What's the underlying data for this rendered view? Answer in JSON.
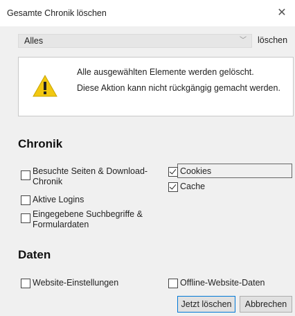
{
  "window": {
    "title": "Gesamte Chronik löschen"
  },
  "range": {
    "selected": "Alles",
    "trailing_label": "löschen"
  },
  "warning": {
    "line1": "Alle ausgewählten Elemente werden gelöscht.",
    "line2": "Diese Aktion kann nicht rückgängig gemacht werden."
  },
  "sections": {
    "history_heading": "Chronik",
    "data_heading": "Daten"
  },
  "history": {
    "visited": {
      "label": "Besuchte Seiten & Download-Chronik",
      "checked": false
    },
    "logins": {
      "label": "Aktive Logins",
      "checked": false
    },
    "forms": {
      "label": "Eingegebene Suchbegriffe & Formulardaten",
      "checked": false
    },
    "cookies": {
      "label": "Cookies",
      "checked": true
    },
    "cache": {
      "label": "Cache",
      "checked": true
    }
  },
  "data": {
    "site_settings": {
      "label": "Website-Einstellungen",
      "checked": false
    },
    "offline": {
      "label": "Offline-Website-Daten",
      "checked": false
    }
  },
  "buttons": {
    "clear_now": "Jetzt löschen",
    "cancel": "Abbrechen"
  },
  "icons": {
    "close": "close-icon",
    "warning": "warning-icon",
    "dropdown": "chevron-down-icon"
  },
  "colors": {
    "focus_border": "#0078d7",
    "warning_yellow": "#f2c811"
  }
}
